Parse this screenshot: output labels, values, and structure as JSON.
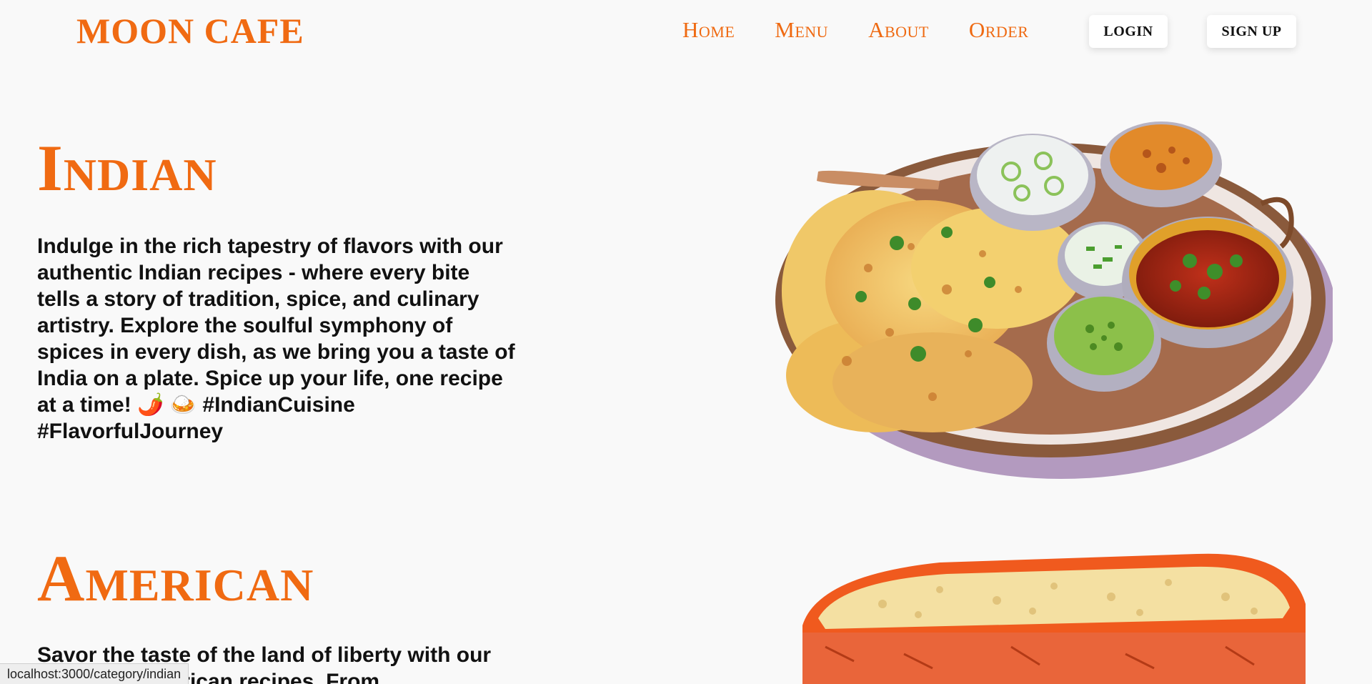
{
  "brand": {
    "name": "MOON CAFE"
  },
  "nav": {
    "home": "Home",
    "menu": "Menu",
    "about": "About",
    "order": "Order",
    "login": "LOGIN",
    "signup": "SIGN UP"
  },
  "sections": {
    "indian": {
      "title": "Indian",
      "description": "Indulge in the rich tapestry of flavors with our authentic Indian recipes - where every bite tells a story of tradition, spice, and culinary artistry. Explore the soulful symphony of spices in every dish, as we bring you a taste of India on a plate. Spice up your life, one recipe at a time! 🌶️ 🍛 #IndianCuisine #FlavorfulJourney"
    },
    "american": {
      "title": "American",
      "description": "Savor the taste of the land of liberty with our delicious American recipes. From"
    }
  },
  "status_bar": {
    "url": "localhost:3000/category/indian"
  },
  "colors": {
    "accent": "#f06a12",
    "background": "#f9f9f9",
    "text": "#111111"
  }
}
